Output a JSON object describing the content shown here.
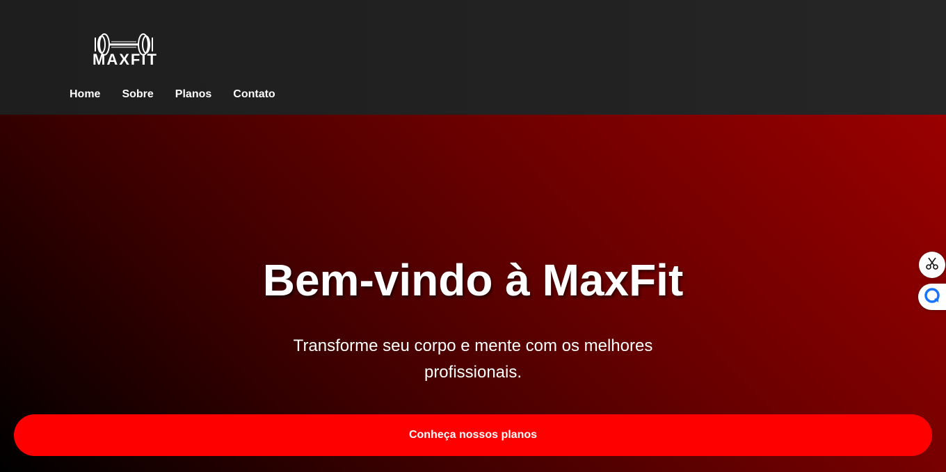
{
  "brand": {
    "logo_text": "MAXFIT",
    "logo_icon": "dumbbell-icon"
  },
  "nav": {
    "items": [
      {
        "label": "Home"
      },
      {
        "label": "Sobre"
      },
      {
        "label": "Planos"
      },
      {
        "label": "Contato"
      }
    ]
  },
  "hero": {
    "title": "Bem-vindo à MaxFit",
    "subtitle": "Transforme seu corpo e mente com os melhores profissionais.",
    "cta_label": "Conheça nossos planos"
  },
  "floating_tools": [
    {
      "icon": "scissors-icon"
    },
    {
      "icon": "chat-bubble-icon"
    }
  ],
  "colors": {
    "header_bg": "#222222",
    "hero_dark": "#000000",
    "hero_red": "#9a0000",
    "cta": "#ff0000",
    "text": "#ffffff",
    "chat_icon": "#1a73ff"
  }
}
